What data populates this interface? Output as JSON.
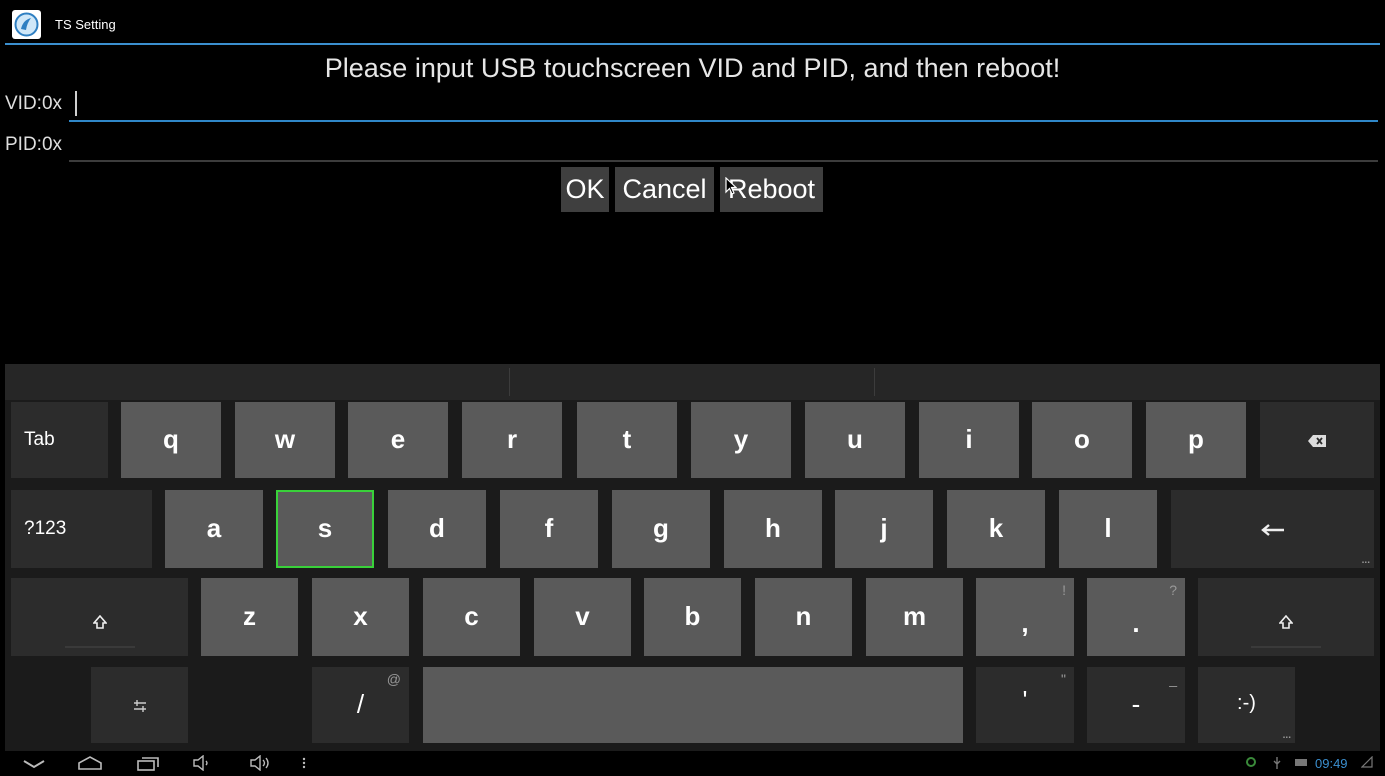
{
  "app": {
    "title": "TS Setting"
  },
  "prompt": "Please input USB touchscreen VID and PID, and then reboot!",
  "vid": {
    "label": "VID:0x",
    "value": ""
  },
  "pid": {
    "label": "PID:0x",
    "value": ""
  },
  "buttons": {
    "ok": "OK",
    "cancel": "Cancel",
    "reboot": "Reboot"
  },
  "keyboard": {
    "tab": "Tab",
    "sym": "?123",
    "row1": [
      "q",
      "w",
      "e",
      "r",
      "t",
      "y",
      "u",
      "i",
      "o",
      "p"
    ],
    "row2": [
      "a",
      "s",
      "d",
      "f",
      "g",
      "h",
      "j",
      "k",
      "l"
    ],
    "row3": [
      "z",
      "x",
      "c",
      "v",
      "b",
      "n",
      "m"
    ],
    "comma": ",",
    "comma_hint": "!",
    "period": ".",
    "period_hint": "?",
    "slash": "/",
    "slash_hint": "@",
    "apos": "'",
    "apos_hint": "\"",
    "dash": "-",
    "dash_hint": "_",
    "smiley": ":-)",
    "selected_key": "s",
    "accent": "#39d13a"
  },
  "statusbar": {
    "time": "09:49"
  },
  "colors": {
    "accent": "#3b8fcf",
    "selected": "#39d13a"
  }
}
